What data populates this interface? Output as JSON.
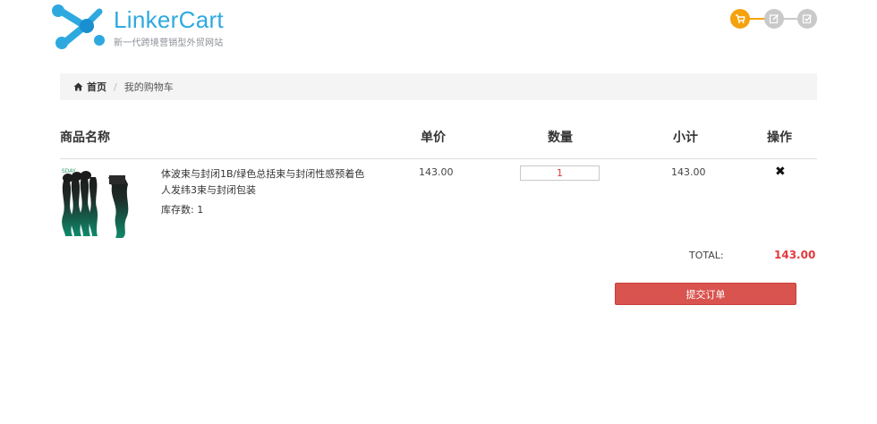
{
  "header": {
    "logo_name": "LinkerCart",
    "logo_subtitle": "新一代跨境营销型外贸网站",
    "brand_color": "#2ea9e0",
    "steps": [
      {
        "icon": "cart-icon",
        "state": "active",
        "color": "#f5a20f"
      },
      {
        "icon": "edit-icon",
        "state": "inactive",
        "color": "#c9c9c9"
      },
      {
        "icon": "check-icon",
        "state": "inactive",
        "color": "#c9c9c9"
      }
    ]
  },
  "breadcrumb": {
    "home": "首页",
    "current": "我的购物车"
  },
  "table": {
    "headers": {
      "name": "商品名称",
      "price": "单价",
      "quantity": "数量",
      "subtotal": "小计",
      "action": "操作"
    },
    "rows": [
      {
        "name": "体波束与封闭1B/绿色总括束与封闭性感预着色人发纬3束与封闭包装",
        "stock": "库存数: 1",
        "price": "143.00",
        "quantity": "1",
        "subtotal": "143.00",
        "delete_icon": "close-icon"
      }
    ]
  },
  "summary": {
    "total_label": "TOTAL:",
    "total_value": "143.00",
    "total_color": "#e4393c"
  },
  "actions": {
    "submit_label": "提交订单",
    "submit_color": "#d9534f"
  }
}
